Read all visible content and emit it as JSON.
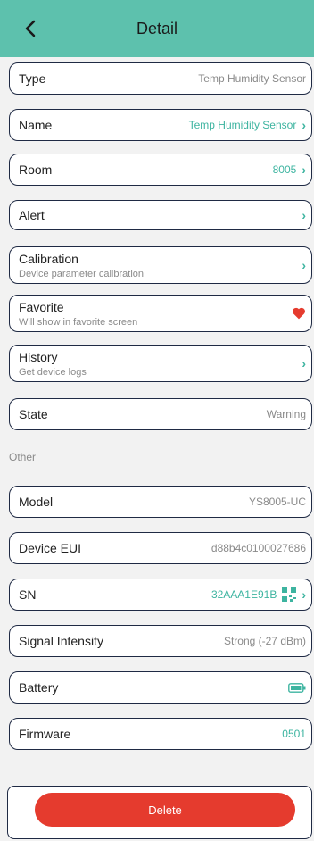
{
  "header": {
    "title": "Detail",
    "back_icon": "chevron-left-icon"
  },
  "rows": {
    "type": {
      "label": "Type",
      "value": "Temp Humidity Sensor"
    },
    "name": {
      "label": "Name",
      "value": "Temp Humidity Sensor"
    },
    "room": {
      "label": "Room",
      "value": "8005"
    },
    "alert": {
      "label": "Alert"
    },
    "calibration": {
      "label": "Calibration",
      "sub": "Device parameter calibration"
    },
    "favorite": {
      "label": "Favorite",
      "sub": "Will show in favorite screen"
    },
    "history": {
      "label": "History",
      "sub": "Get device logs"
    },
    "state": {
      "label": "State",
      "value": "Warning"
    }
  },
  "other": {
    "section_title": "Other",
    "model": {
      "label": "Model",
      "value": "YS8005-UC"
    },
    "device_eui": {
      "label": "Device EUI",
      "value": "d88b4c0100027686"
    },
    "sn": {
      "label": "SN",
      "value": "32AAA1E91B"
    },
    "signal": {
      "label": "Signal Intensity",
      "value": "Strong (-27 dBm)"
    },
    "battery": {
      "label": "Battery"
    },
    "firmware": {
      "label": "Firmware",
      "value": "0501"
    }
  },
  "actions": {
    "delete_label": "Delete"
  },
  "colors": {
    "accent": "#5dc1ad",
    "teal_text": "#3db4a0",
    "danger": "#e53b2e"
  }
}
